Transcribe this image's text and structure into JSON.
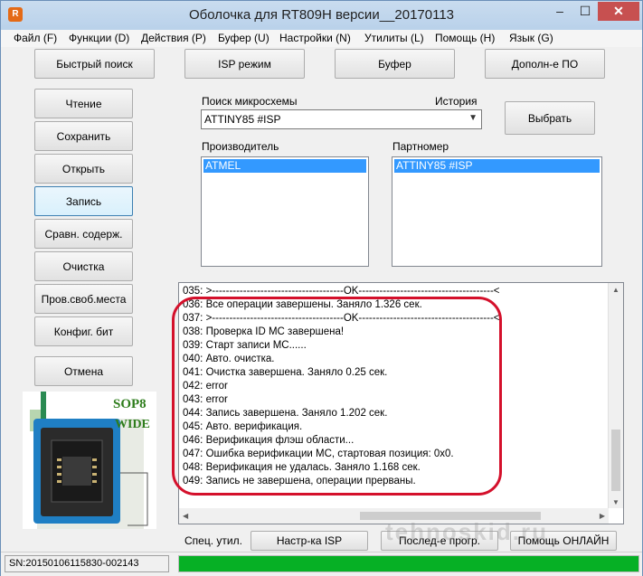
{
  "window": {
    "title": "Оболочка для RT809H версии__20170113",
    "controls": {
      "min": "–",
      "max": "☐",
      "close": "✕"
    }
  },
  "menu": [
    "Файл (F)",
    "Функции (D)",
    "Действия (P)",
    "Буфер (U)",
    "Настройки (N)",
    "Утилиты (L)",
    "Помощь (H)",
    "Язык (G)"
  ],
  "top_buttons": [
    "Быстрый поиск",
    "ISP режим",
    "Буфер",
    "Дополн-е ПО"
  ],
  "side_buttons": [
    "Чтение",
    "Сохранить",
    "Открыть",
    "Запись",
    "Сравн. содерж.",
    "Очистка",
    "Пров.своб.места",
    "Конфиг. бит"
  ],
  "cancel_button": "Отмена",
  "chip_search": {
    "label": "Поиск микросхемы",
    "history_label": "История",
    "value": "ATTINY85 #ISP",
    "select_button": "Выбрать"
  },
  "manufacturer": {
    "label": "Производитель",
    "selected": "ATMEL"
  },
  "partnumber": {
    "label": "Партномер",
    "selected": "ATTINY85 #ISP"
  },
  "adapter_image": {
    "line1": "SOP8",
    "line2": "WIDE"
  },
  "log": [
    "035:  >--------------------------------------OK---------------------------------------<",
    "036:  Все операции завершены. Заняло 1.326 сек.",
    "037:  >--------------------------------------OK---------------------------------------<",
    "038:  Проверка ID МС завершена!",
    "039:  Старт записи МС......",
    "040:  Авто. очистка.",
    "041:  Очистка завершена. Заняло 0.25 сек.",
    "042:  error",
    "043:  error",
    "044:  Запись завершена. Заняло 1.202 сек.",
    "045:  Авто. верификация.",
    "046:  Верификация флэш области...",
    "047:  Ошибка верификации МС, стартовая позиция: 0x0.",
    "048:  Верификация не удалась. Заняло 1.168 сек.",
    "049:  Запись не завершена, операции прерваны."
  ],
  "bottom": {
    "spec_label": "Спец. утил.",
    "isp_button": "Настр-ка ISP",
    "last_button": "Послед-е прогр.",
    "help_button": "Помощь ОНЛАЙН"
  },
  "status": {
    "serial": "SN:20150106115830-002143",
    "progress": 1.0
  },
  "watermark": "tehnoskid.ru",
  "colors": {
    "selection": "#3399ff",
    "progress": "#06b025",
    "highlight": "#d4102b"
  }
}
